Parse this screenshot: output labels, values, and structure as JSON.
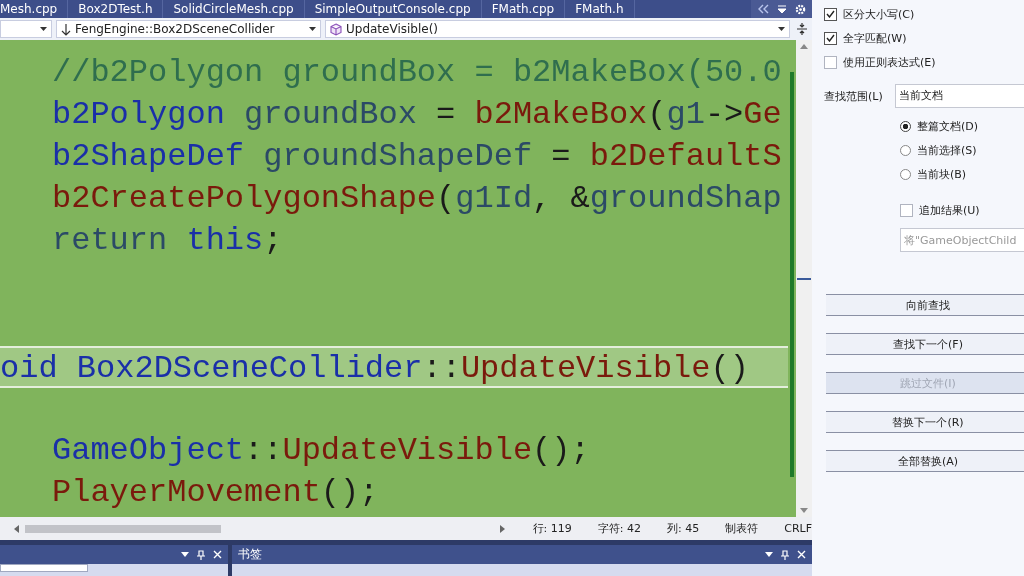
{
  "tabs": [
    {
      "label": "Mesh.cpp",
      "selected": false
    },
    {
      "label": "Box2DTest.h",
      "selected": false
    },
    {
      "label": "SolidCircleMesh.cpp",
      "selected": false
    },
    {
      "label": "SimpleOutputConsole.cpp",
      "selected": false
    },
    {
      "label": "FMath.cpp",
      "selected": false
    },
    {
      "label": "FMath.h",
      "selected": false
    }
  ],
  "navigation": {
    "scope": "FengEngine::Box2DSceneCollider",
    "member": "UpdateVisible()"
  },
  "code_lines": [
    {
      "kind": "code",
      "tokens": [
        {
          "kind": "comment",
          "text": "//b2Polygon groundBox = b2MakeBox(50.0"
        }
      ]
    },
    {
      "kind": "code",
      "tokens": [
        {
          "kind": "type",
          "text": "b2Polygon"
        },
        {
          "kind": "var",
          "text": " groundBox"
        },
        {
          "kind": "plain",
          "text": " = "
        },
        {
          "kind": "func",
          "text": "b2MakeBox"
        },
        {
          "kind": "plain",
          "text": "("
        },
        {
          "kind": "var",
          "text": "g1"
        },
        {
          "kind": "plain",
          "text": "->"
        },
        {
          "kind": "func",
          "text": "Ge"
        }
      ]
    },
    {
      "kind": "code",
      "tokens": [
        {
          "kind": "type",
          "text": "b2ShapeDef"
        },
        {
          "kind": "var",
          "text": " groundShapeDef"
        },
        {
          "kind": "plain",
          "text": " = "
        },
        {
          "kind": "func",
          "text": "b2DefaultS"
        }
      ]
    },
    {
      "kind": "code",
      "tokens": [
        {
          "kind": "func",
          "text": "b2CreatePolygonShape"
        },
        {
          "kind": "plain",
          "text": "("
        },
        {
          "kind": "var",
          "text": "g1Id"
        },
        {
          "kind": "plain",
          "text": ", &"
        },
        {
          "kind": "var",
          "text": "groundShap"
        }
      ]
    },
    {
      "kind": "code",
      "tokens": [
        {
          "kind": "var",
          "text": "return"
        },
        {
          "kind": "type",
          "text": " this"
        },
        {
          "kind": "plain",
          "text": ";"
        }
      ]
    },
    {
      "kind": "blank"
    },
    {
      "kind": "blank"
    },
    {
      "kind": "signature",
      "tokens": [
        {
          "kind": "type",
          "text": "oid Box2DSceneCollider"
        },
        {
          "kind": "plain",
          "text": "::"
        },
        {
          "kind": "func",
          "text": "UpdateVisible"
        },
        {
          "kind": "plain",
          "text": "()"
        }
      ]
    },
    {
      "kind": "blank"
    },
    {
      "kind": "code",
      "tokens": [
        {
          "kind": "type",
          "text": "GameObject"
        },
        {
          "kind": "plain",
          "text": "::"
        },
        {
          "kind": "func",
          "text": "UpdateVisible"
        },
        {
          "kind": "plain",
          "text": "();"
        }
      ]
    },
    {
      "kind": "code",
      "tokens": [
        {
          "kind": "func",
          "text": "PlayerMovement"
        },
        {
          "kind": "plain",
          "text": "();"
        }
      ]
    }
  ],
  "status_bar": [
    "行: 119",
    "字符: 42",
    "列: 45",
    "制表符",
    "CRLF"
  ],
  "bookmarks_panel": {
    "title": "书签"
  },
  "find_options": {
    "checkboxes": [
      {
        "label": "区分大小写(C)",
        "checked": true
      },
      {
        "label": "全字匹配(W)",
        "checked": true
      },
      {
        "label": "使用正则表达式(E)",
        "checked": false
      }
    ],
    "scope_label": "查找范围(L)",
    "scope_value": "当前文档",
    "radios": [
      {
        "label": "整篇文档(D)",
        "selected": true
      },
      {
        "label": "当前选择(S)",
        "selected": false
      },
      {
        "label": "当前块(B)",
        "selected": false
      }
    ],
    "append": {
      "label": "追加结果(U)",
      "checked": false
    },
    "replace_placeholder": "将\"GameObjectChild",
    "buttons": [
      {
        "label": "向前查找",
        "disabled": false
      },
      {
        "label": "查找下一个(F)",
        "disabled": false
      },
      {
        "label": "跳过文件(I)",
        "disabled": true
      },
      {
        "label": "替换下一个(R)",
        "disabled": false
      },
      {
        "label": "全部替换(A)",
        "disabled": false
      }
    ]
  }
}
